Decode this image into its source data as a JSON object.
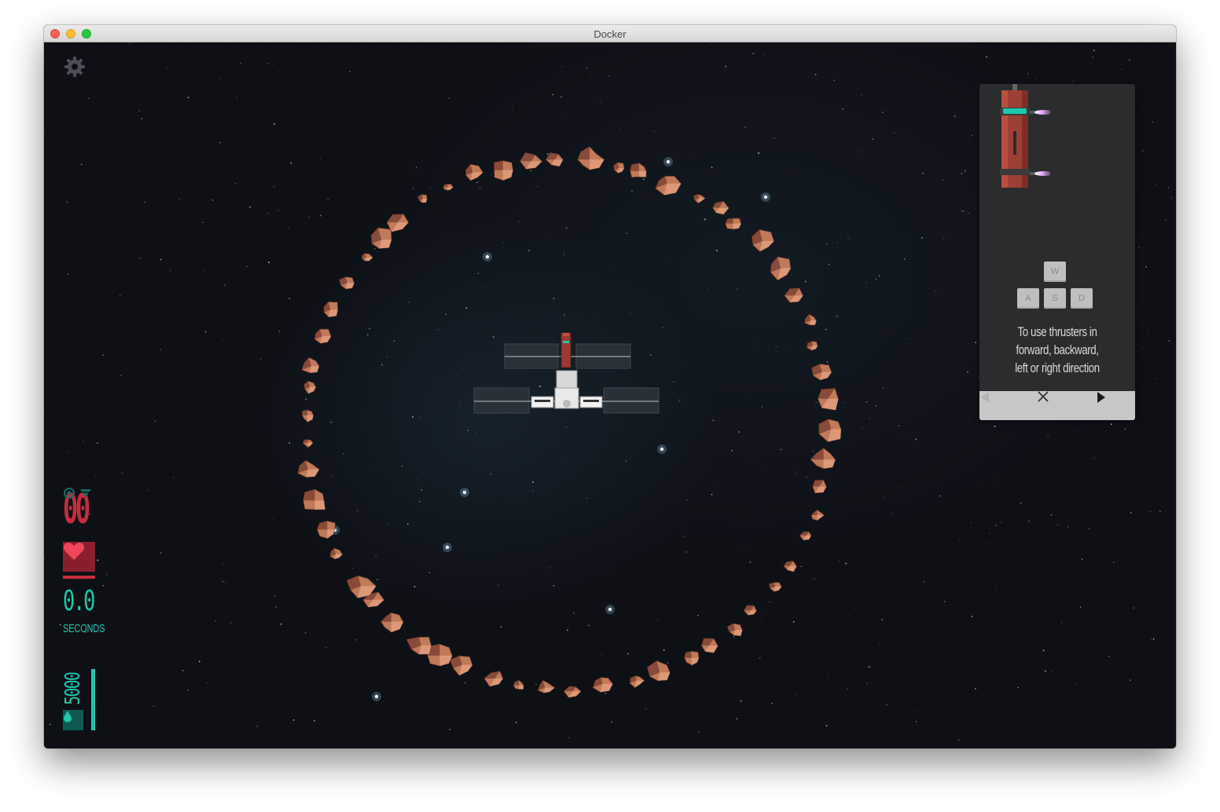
{
  "window": {
    "title": "Docker"
  },
  "hud": {
    "score": "00",
    "time_value": "0.0",
    "time_label": "SECONDS",
    "fuel_value": "5000",
    "health_fraction": 1.0,
    "fuel_fraction": 1.0,
    "colors": {
      "health": "#c42d3f",
      "timer": "#1ec8ad"
    }
  },
  "tutorial": {
    "keys": {
      "up": "W",
      "left": "A",
      "down": "S",
      "right": "D"
    },
    "text": "To use thrusters in forward, backward, left or right direction",
    "nav": {
      "prev_icon": "triangle-left-icon",
      "close_icon": "close-icon",
      "next_icon": "triangle-right-icon"
    }
  },
  "icons": {
    "settings": "gear-icon",
    "heart": "heart-icon",
    "drop": "drop-icon"
  }
}
